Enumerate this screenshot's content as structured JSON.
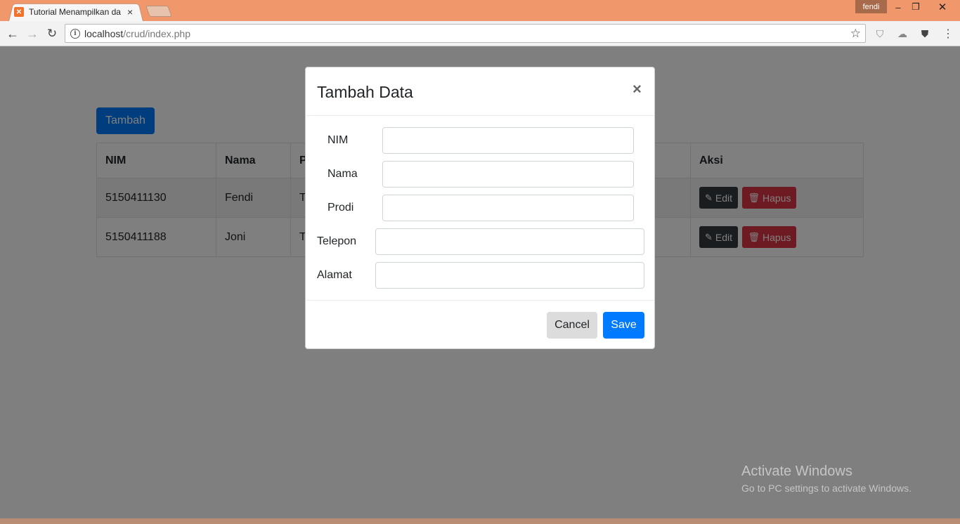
{
  "browser": {
    "tab_title": "Tutorial Menampilkan da",
    "tab_close": "×",
    "user": "fendi",
    "url_host": "localhost",
    "url_path": "/crud/index.php",
    "window_controls": {
      "minimize": "–",
      "maximize": "❐",
      "close": "✕"
    }
  },
  "page": {
    "add_button": "Tambah",
    "table": {
      "headers": [
        "NIM",
        "Nama",
        "P",
        "Aksi"
      ],
      "rows": [
        {
          "nim": "5150411130",
          "nama": "Fendi",
          "prodi": "T",
          "edit": "Edit",
          "hapus": "Hapus"
        },
        {
          "nim": "5150411188",
          "nama": "Joni",
          "prodi": "T",
          "edit": "Edit",
          "hapus": "Hapus"
        }
      ]
    }
  },
  "modal": {
    "title": "Tambah Data",
    "close": "×",
    "fields": {
      "nim": {
        "label": "NIM",
        "value": ""
      },
      "nama": {
        "label": "Nama",
        "value": ""
      },
      "prodi": {
        "label": "Prodi",
        "value": ""
      },
      "telepon": {
        "label": "Telepon",
        "value": ""
      },
      "alamat": {
        "label": "Alamat",
        "value": ""
      }
    },
    "cancel": "Cancel",
    "save": "Save"
  },
  "watermark": {
    "title": "Activate Windows",
    "subtitle": "Go to PC settings to activate Windows."
  },
  "colors": {
    "primary": "#007bff",
    "dark": "#343a40",
    "danger": "#dc3545",
    "titlebar": "#f0986c"
  }
}
